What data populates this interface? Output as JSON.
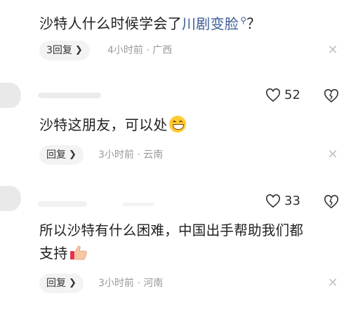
{
  "comments": [
    {
      "text_before": "沙特人什么时候学会了",
      "topic_link": "川剧变脸",
      "search_glyph": "⚲",
      "text_after": "？",
      "reply_label": "3回复",
      "time": "4小时前",
      "location": "广西"
    },
    {
      "likes": "52",
      "text": "沙特这朋友，可以处",
      "emoji": "grinning-face-emoji",
      "reply_label": "回复",
      "time": "3小时前",
      "location": "云南"
    },
    {
      "likes": "33",
      "text_line1": "所以沙特有什么困难，中国出手帮助我们都",
      "text_line2": "支持",
      "emoji": "thumbs-up-emoji",
      "reply_label": "回复",
      "time": "3小时前",
      "location": "河南"
    }
  ],
  "separator": "·",
  "icons": {
    "like": "heart-outline-icon",
    "dislike": "broken-heart-icon",
    "close": "close-icon",
    "chevron": "chevron-right-icon"
  },
  "colors": {
    "topic_link": "#3b5c95",
    "meta": "#9a9a9a",
    "pill_bg": "#f3f3f3"
  }
}
